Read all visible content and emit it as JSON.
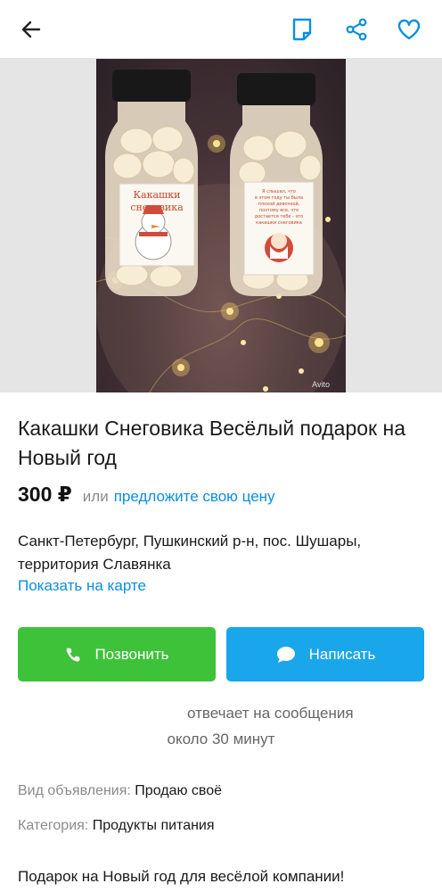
{
  "header": {
    "back_icon": "arrow-left-icon",
    "note_icon": "note-icon",
    "share_icon": "share-icon",
    "favorite_icon": "heart-icon",
    "accent": "#0a8fdf"
  },
  "gallery": {
    "watermark": "Avito",
    "label_left_line1": "Какашки",
    "label_left_line2": "снеговика",
    "label_right_text": "Я слышал, что в этом году ты был плохой девочкой, поэтому все, что достается тебе - это какашки снеговика"
  },
  "listing": {
    "title": "Какашки Снеговика Весёлый подарок на Новый год",
    "price": "300 ₽",
    "price_or": "или",
    "price_offer": "предложите свою цену",
    "address": "Санкт-Петербург, Пушкинский р-н, пос. Шушары, территория Славянка",
    "map_link": "Показать на карте"
  },
  "actions": {
    "call_label": "Позвонить",
    "write_label": "Написать",
    "call_color": "#3ec23a",
    "write_color": "#1aa6ea"
  },
  "seller": {
    "responds_line1": "отвечает на сообщения",
    "responds_line2": "около 30 минут"
  },
  "params": [
    {
      "key": "Вид объявления:",
      "value": "Продаю своё"
    },
    {
      "key": "Категория:",
      "value": "Продукты питания"
    }
  ],
  "description": "Подарок на Новый год для весёлой компании!"
}
